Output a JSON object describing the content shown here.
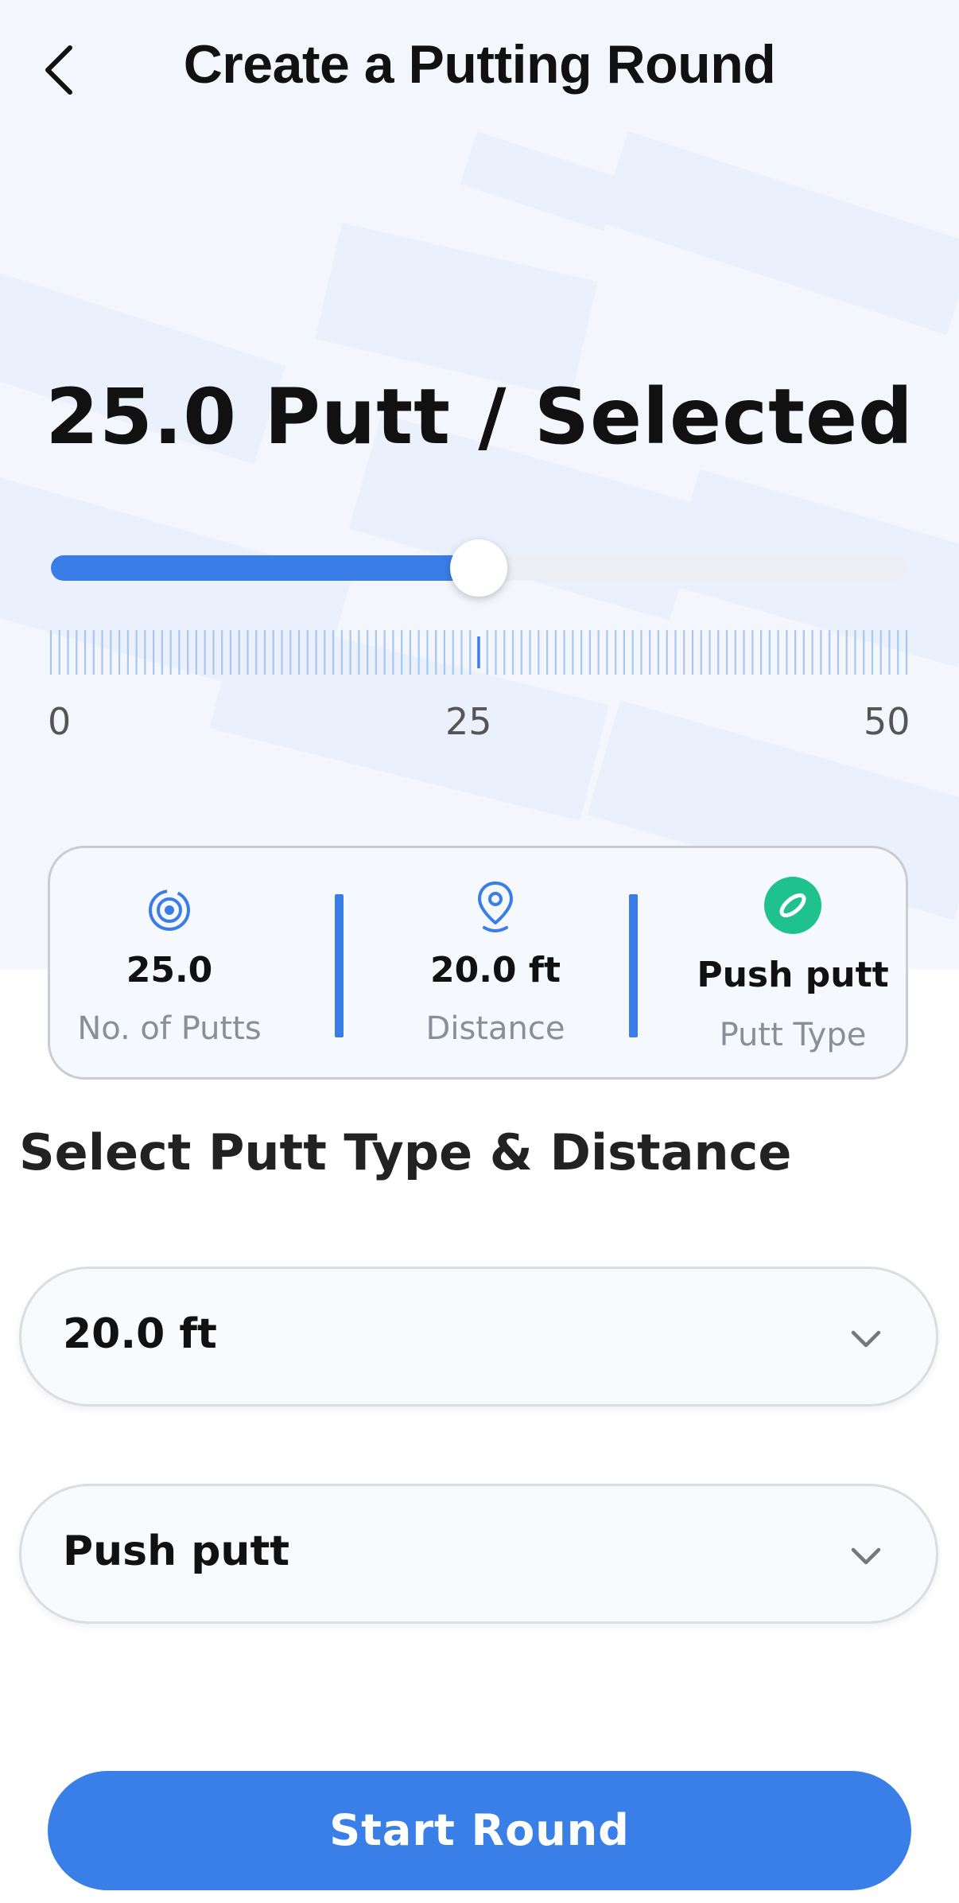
{
  "header": {
    "title": "Create a Putting Round"
  },
  "selection": {
    "heading": "25.0 Putt / Selected"
  },
  "slider": {
    "min_label": "0",
    "mid_label": "25",
    "max_label": "50",
    "min": 0,
    "max": 50,
    "value": 25,
    "fill_color": "#3b7de6",
    "track_color": "#eceff3"
  },
  "stats": {
    "putts": {
      "value": "25.0",
      "label": "No. of Putts",
      "icon": "target-icon"
    },
    "distance": {
      "value": "20.0 ft",
      "label": "Distance",
      "icon": "location-pin-icon"
    },
    "putt_type": {
      "value": "Push putt",
      "label": "Putt Type",
      "icon": "golf-ball-icon",
      "icon_color": "#1fc28c"
    }
  },
  "section": {
    "title": "Select Putt Type & Distance"
  },
  "dropdowns": {
    "distance": {
      "value": "20.0 ft",
      "icon": "chevron-down-icon"
    },
    "putt_type": {
      "value": "Push putt",
      "icon": "chevron-down-icon"
    }
  },
  "actions": {
    "start_label": "Start Round"
  },
  "colors": {
    "accent": "#3a7ee8",
    "hero_background": "#f3f7fd",
    "ruler_tick": "#a9c6f2",
    "ruler_active_tick": "#3b7de6"
  }
}
